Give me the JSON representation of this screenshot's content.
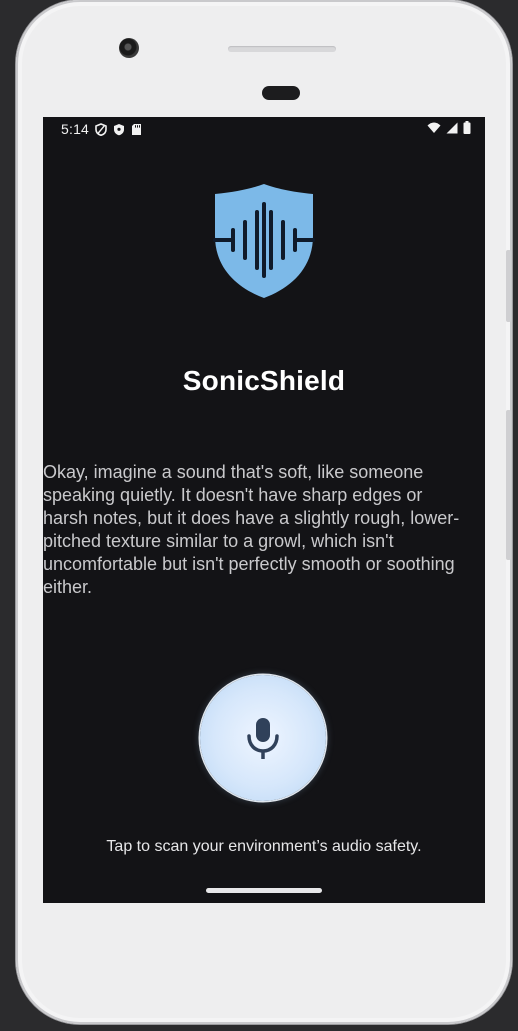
{
  "status_bar": {
    "time": "5:14",
    "left_icons": [
      "shield-outline-icon",
      "shield-filled-icon",
      "sd-card-icon"
    ],
    "right_icons": [
      "wifi-icon",
      "cell-signal-icon",
      "battery-icon"
    ]
  },
  "app": {
    "logo": "sound-shield-logo",
    "title": "SonicShield",
    "description": "Okay, imagine a sound that's soft, like someone speaking quietly. It doesn't have sharp edges or harsh notes, but it does have a slightly rough, lower-pitched texture similar to a growl, which isn't uncomfortable but isn't perfectly smooth or soothing either.",
    "mic_icon": "microphone-icon",
    "hint": "Tap to scan your environment’s audio safety."
  },
  "colors": {
    "screen_background": "#131316",
    "logo_shield": "#7cb9e8",
    "logo_waves": "#0f1a2a",
    "mic_button": "#d6e7fb",
    "mic_icon": "#30415a"
  }
}
